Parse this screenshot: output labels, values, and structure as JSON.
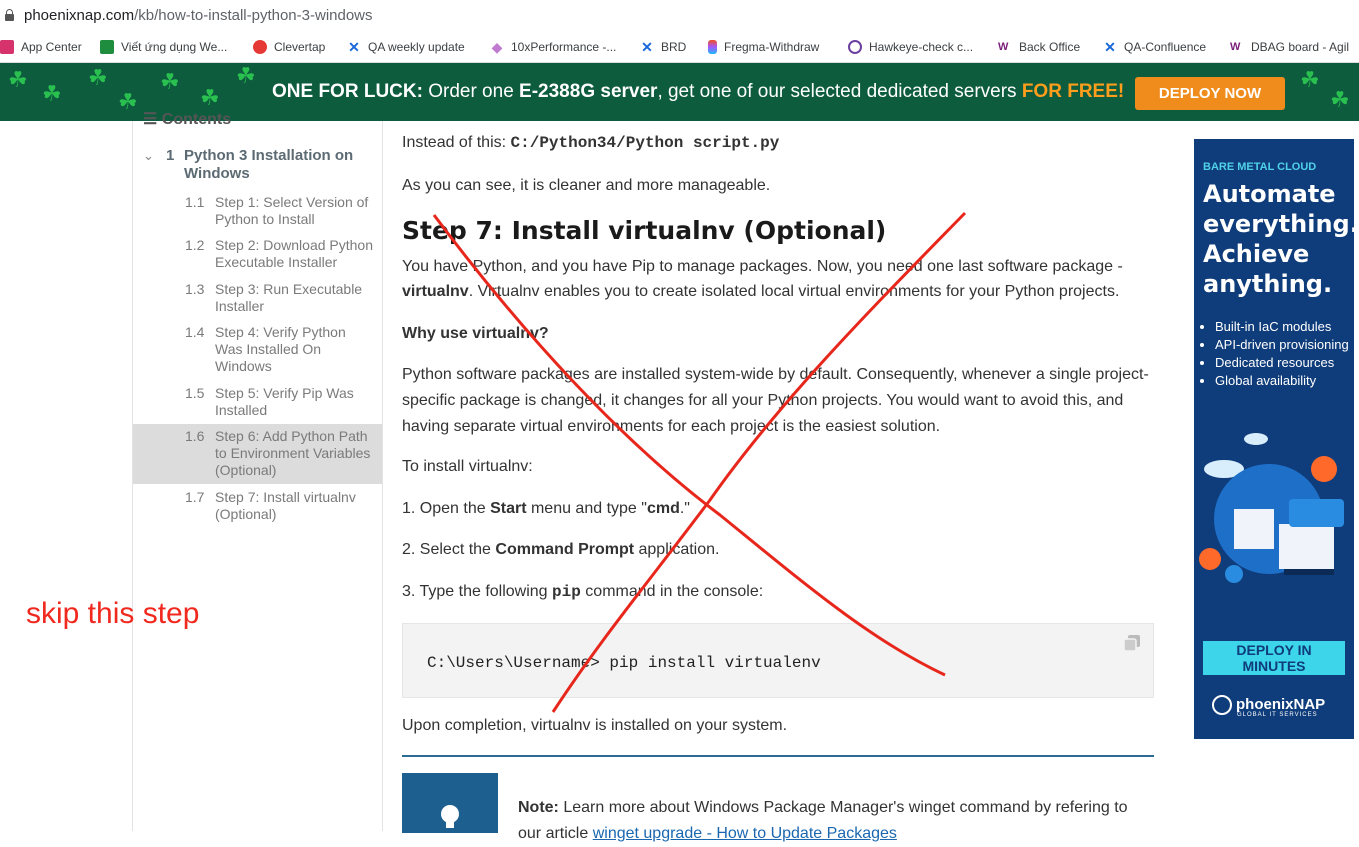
{
  "browser": {
    "url_host": "phoenixnap.com",
    "url_path": "/kb/how-to-install-python-3-windows"
  },
  "bookmarks": [
    {
      "label": "App Center"
    },
    {
      "label": "Viết ứng dụng We..."
    },
    {
      "label": "Clevertap"
    },
    {
      "label": "QA weekly update"
    },
    {
      "label": "10xPerformance -..."
    },
    {
      "label": "BRD"
    },
    {
      "label": "Fregma-Withdraw"
    },
    {
      "label": "Hawkeye-check c..."
    },
    {
      "label": "Back Office"
    },
    {
      "label": "QA-Confluence"
    },
    {
      "label": "DBAG board - Agil"
    }
  ],
  "promo": {
    "lead": "ONE FOR LUCK:",
    "middle_1": " Order one ",
    "server": "E-2388G server",
    "middle_2": ", get one of our selected dedicated servers ",
    "free": "FOR FREE!",
    "button": "DEPLOY NOW"
  },
  "sidebar": {
    "contents_label": "Contents",
    "section_num": "1",
    "section_label": "Python 3 Installation on Windows",
    "items": [
      {
        "num": "1.1",
        "label": "Step 1: Select Version of Python to Install"
      },
      {
        "num": "1.2",
        "label": "Step 2: Download Python Executable Installer"
      },
      {
        "num": "1.3",
        "label": "Step 3: Run Executable Installer"
      },
      {
        "num": "1.4",
        "label": "Step 4: Verify Python Was Installed On Windows"
      },
      {
        "num": "1.5",
        "label": "Step 5: Verify Pip Was Installed"
      },
      {
        "num": "1.6",
        "label": "Step 6: Add Python Path to Environment Variables (Optional)"
      },
      {
        "num": "1.7",
        "label": "Step 7: Install virtualnv (Optional)"
      }
    ],
    "annotation": "skip this step"
  },
  "article": {
    "instead_prefix": "Instead of this: ",
    "instead_code": "C:/Python34/Python script.py",
    "cleaner": "As you can see, it is cleaner and more manageable.",
    "heading": "Step 7: Install virtualnv (Optional)",
    "intro_1": "You have Python, and you have Pip to manage packages. Now, you need one last software package - ",
    "intro_bold": "virtualnv",
    "intro_2": ". Virtualnv enables you to create isolated local virtual environments for your Python projects.",
    "why": "Why use virtualnv?",
    "why_body": "Python software packages are installed system-wide by default. Consequently, whenever a single project-specific package is changed, it changes for all your Python projects. You would want to avoid this, and having separate virtual environments for each project is the easiest solution.",
    "to_install": "To install virtualnv:",
    "step1_a": "1. Open the ",
    "step1_b": "Start",
    "step1_c": " menu and type \"",
    "step1_d": "cmd",
    "step1_e": ".\"",
    "step2_a": "2. Select the ",
    "step2_b": "Command Prompt",
    "step2_c": " application.",
    "step3_a": "3. Type the following ",
    "step3_b": "pip",
    "step3_c": " command in the console:",
    "code": "C:\\Users\\Username> pip install virtualenv",
    "completion": "Upon completion, virtualnv is installed on your system.",
    "note_label": "Note:",
    "note_text": " Learn more about Windows Package Manager's winget command by refering to our article ",
    "note_link": "winget upgrade - How to Update Packages"
  },
  "ad": {
    "tag": "BARE METAL CLOUD",
    "headline": "Automate everything. Achieve anything.",
    "bullets": [
      "Built-in IaC modules",
      "API-driven provisioning",
      "Dedicated resources",
      "Global availability"
    ],
    "button": "DEPLOY IN MINUTES",
    "logo": "phoenixNAP",
    "logo_sub": "GLOBAL IT SERVICES"
  },
  "colors": {
    "promo_bg": "#0d5c3e",
    "accent_orange": "#f08c1c",
    "ad_bg": "#0f3c7a",
    "ad_button": "#3cd5ea",
    "annotation_red": "#f0281e"
  }
}
